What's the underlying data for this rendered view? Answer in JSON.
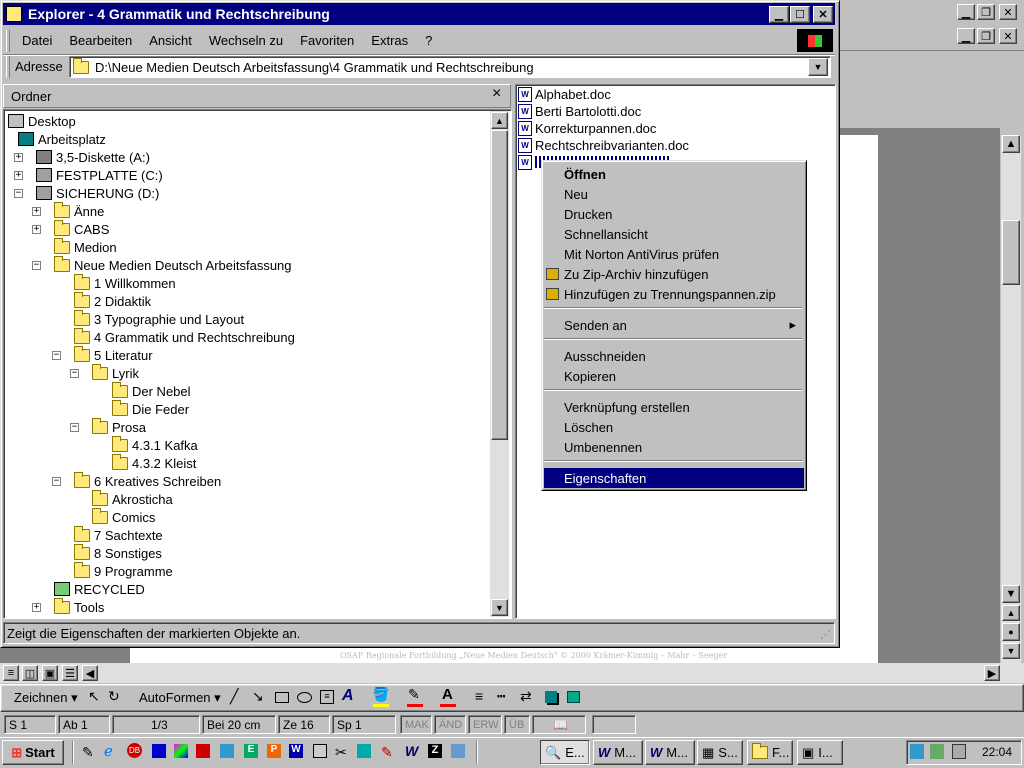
{
  "word": {
    "footer": "OSAF Regionale Fortbildung „Neue Medien Deutsch\" © 2000  Krämer-Kimmig – Mahr – Seeger"
  },
  "explorer": {
    "title": "Explorer - 4 Grammatik und Rechtschreibung",
    "menu": [
      "Datei",
      "Bearbeiten",
      "Ansicht",
      "Wechseln zu",
      "Favoriten",
      "Extras",
      "?"
    ],
    "address_label": "Adresse",
    "address_value": "D:\\Neue Medien Deutsch Arbeitsfassung\\4 Grammatik und Rechtschreibung",
    "folder_pane_title": "Ordner",
    "close_glyph": "×",
    "tree": [
      {
        "label": "Desktop"
      },
      {
        "label": "Arbeitsplatz"
      },
      {
        "label": "3,5-Diskette (A:)"
      },
      {
        "label": "FESTPLATTE (C:)"
      },
      {
        "label": "SICHERUNG (D:)"
      },
      {
        "label": "Änne"
      },
      {
        "label": "CABS"
      },
      {
        "label": "Medion"
      },
      {
        "label": "Neue Medien Deutsch Arbeitsfassung"
      },
      {
        "label": "1 Willkommen"
      },
      {
        "label": "2 Didaktik"
      },
      {
        "label": "3 Typographie und Layout"
      },
      {
        "label": "4 Grammatik und Rechtschreibung"
      },
      {
        "label": "5 Literatur"
      },
      {
        "label": "Lyrik"
      },
      {
        "label": "Der Nebel"
      },
      {
        "label": "Die Feder"
      },
      {
        "label": "Prosa"
      },
      {
        "label": "4.3.1 Kafka"
      },
      {
        "label": "4.3.2 Kleist"
      },
      {
        "label": "6 Kreatives  Schreiben"
      },
      {
        "label": "Akrosticha"
      },
      {
        "label": "Comics"
      },
      {
        "label": "7 Sachtexte"
      },
      {
        "label": "8 Sonstiges"
      },
      {
        "label": "9 Programme"
      },
      {
        "label": "RECYCLED"
      },
      {
        "label": "Tools"
      }
    ],
    "files": [
      "Alphabet.doc",
      "Berti Bartolotti.doc",
      "Korrekturpannen.doc",
      "Rechtschreibvarianten.doc"
    ],
    "status": "Zeigt die Eigenschaften der markierten Objekte an."
  },
  "context_menu": {
    "items": [
      "Öffnen",
      "Neu",
      "Drucken",
      "Schnellansicht",
      "Mit Norton AntiVirus prüfen",
      "Zu Zip-Archiv hinzufügen",
      "Hinzufügen zu Trennungspannen.zip",
      "Senden an",
      "Ausschneiden",
      "Kopieren",
      "Verknüpfung erstellen",
      "Löschen",
      "Umbenennen",
      "Eigenschaften"
    ]
  },
  "drawing_toolbar": {
    "draw": "Zeichnen",
    "autoshapes": "AutoFormen"
  },
  "word_status": {
    "cells": [
      "S 1",
      "Ab 1",
      "1/3",
      "Bei 20 cm",
      "Ze 16",
      "Sp 1",
      "MAK",
      "ÄND",
      "ERW",
      "ÜB"
    ]
  },
  "taskbar": {
    "start": "Start",
    "tasks": [
      "E...",
      "M...",
      "M...",
      "S...",
      "F...",
      "I..."
    ],
    "time": "22:04",
    "task_letters": [
      "W",
      "W"
    ]
  }
}
